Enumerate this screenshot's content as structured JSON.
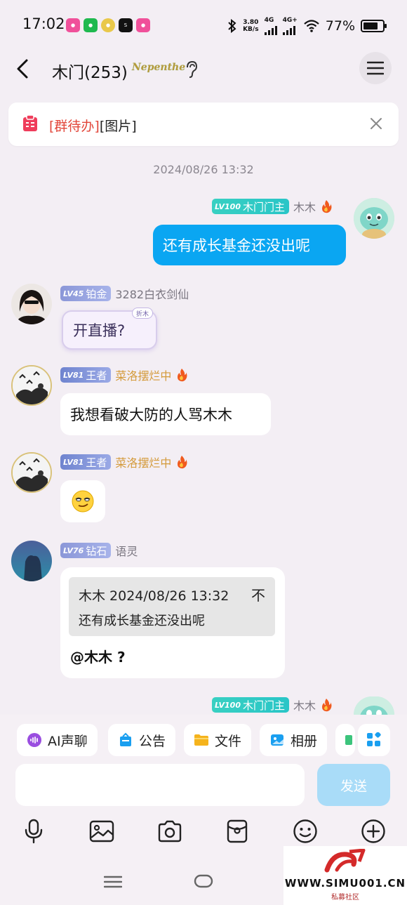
{
  "status_bar": {
    "time": "17:02",
    "speed_value": "3.80",
    "speed_unit": "KB/s",
    "net1": "4G",
    "net2": "4G+",
    "battery": "77%",
    "battery_level": 0.77
  },
  "header": {
    "title": "木门(253)",
    "badge": "Nepenthe"
  },
  "todo": {
    "tag": "[群待办]",
    "content": "[图片]"
  },
  "timestamp": "2024/08/26 13:32",
  "messages": [
    {
      "lv": "LV100",
      "title": "木门门主",
      "sender": "木木",
      "text": "还有成长基金还没出呢"
    },
    {
      "lv": "LV45",
      "title": "铂金",
      "sender": "3282白衣剑仙",
      "text": "开直播?",
      "tag": "折木"
    },
    {
      "lv": "LV81",
      "title": "王者",
      "sender": "菜洛摆烂中",
      "text": "我想看破大防的人骂木木"
    },
    {
      "lv": "LV81",
      "title": "王者",
      "sender": "菜洛摆烂中",
      "emoji": "😏"
    },
    {
      "lv": "LV76",
      "title": "钻石",
      "sender": "语灵",
      "quote_head": "木木 2024/08/26 13:32",
      "quote_mark": "不",
      "quote_body": "还有成长基金还没出呢",
      "reply": "@木木 ?"
    },
    {
      "lv": "LV100",
      "title": "木门门主",
      "sender": "木木"
    }
  ],
  "shortcuts": [
    {
      "label": "AI声聊",
      "icon": "ai-voice-icon",
      "color": "#9a4ee0"
    },
    {
      "label": "公告",
      "icon": "announcement-icon",
      "color": "#1a9ff0"
    },
    {
      "label": "文件",
      "icon": "folder-icon",
      "color": "#f5b31c"
    },
    {
      "label": "相册",
      "icon": "album-icon",
      "color": "#1a9ff0"
    }
  ],
  "input": {
    "placeholder": "",
    "send_label": "发送"
  },
  "watermark": {
    "url": "WWW.SIMU001.CN",
    "sub": "私募社区"
  }
}
